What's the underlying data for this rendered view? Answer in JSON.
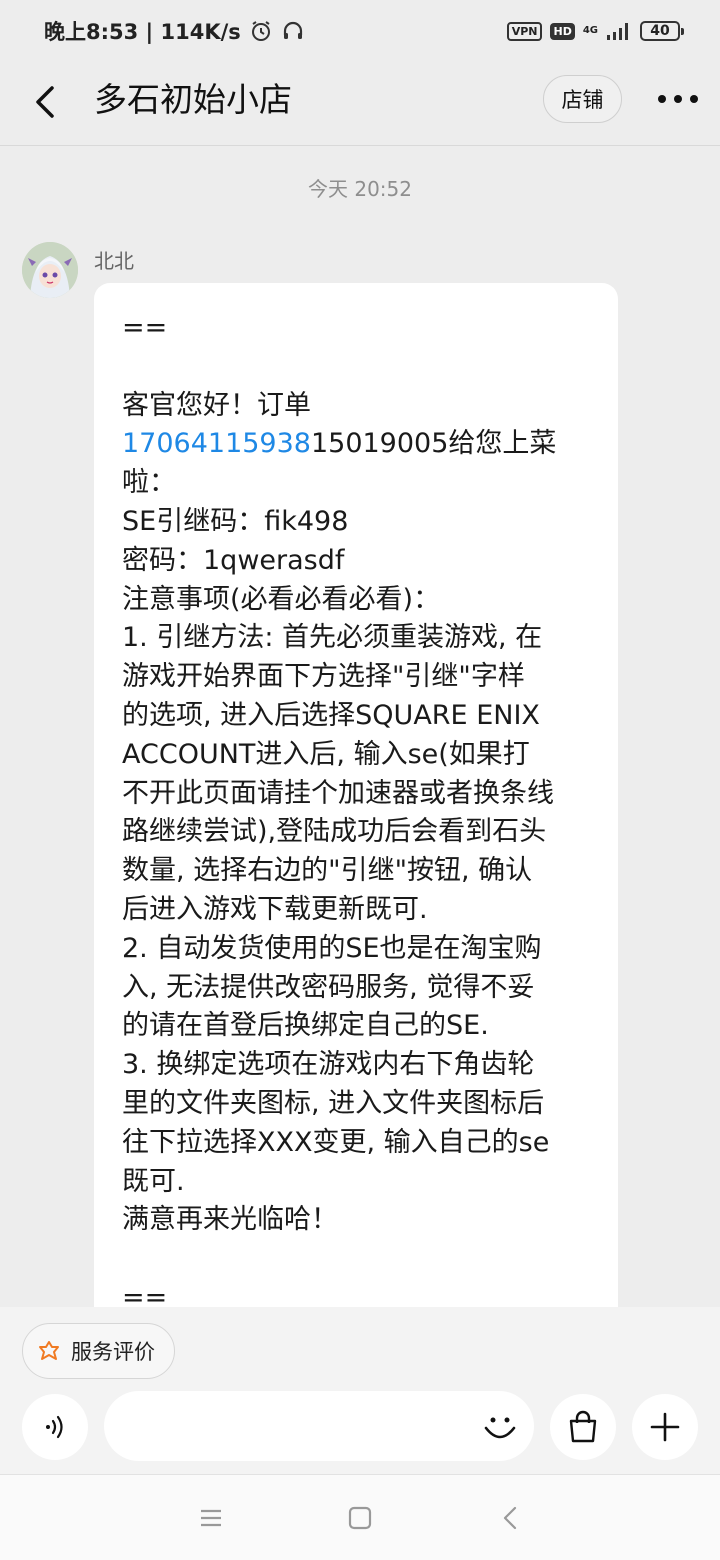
{
  "status_bar": {
    "time": "晚上8:53 | 114K/s",
    "vpn": "VPN",
    "hd": "HD",
    "network": "4G",
    "battery": "40"
  },
  "header": {
    "title": "多石初始小店",
    "shop_label": "店铺"
  },
  "chat": {
    "timestamp": "今天  20:52",
    "sender": "北北",
    "message_lines": [
      "==",
      "",
      "客官您好！订单",
      "__LINK__",
      "啦：",
      "SE引继码：fik498",
      "密码：1qwerasdf",
      "注意事项(必看必看必看)：",
      "1. 引继方法: 首先必须重装游戏, 在",
      "游戏开始界面下方选择\"引继\"字样",
      "的选项, 进入后选择SQUARE ENIX",
      "ACCOUNT进入后, 输入se(如果打",
      "不开此页面请挂个加速器或者换条线",
      "路继续尝试),登陆成功后会看到石头",
      "数量, 选择右边的\"引继\"按钮, 确认",
      "后进入游戏下载更新既可.",
      "2. 自动发货使用的SE也是在淘宝购",
      "入, 无法提供改密码服务, 觉得不妥",
      "的请在首登后换绑定自己的SE.",
      "3. 换绑定选项在游戏内右下角齿轮",
      "里的文件夹图标, 进入文件夹图标后",
      "往下拉选择XXX变更, 输入自己的se",
      "既可.",
      "满意再来光临哈！",
      "",
      "=="
    ],
    "order_link": "17064115938",
    "order_rest": "15019005给您上菜"
  },
  "bottom": {
    "review_label": "服务评价",
    "input_placeholder": ""
  },
  "colors": {
    "link": "#1e88e5",
    "review_icon": "#f07a22"
  }
}
